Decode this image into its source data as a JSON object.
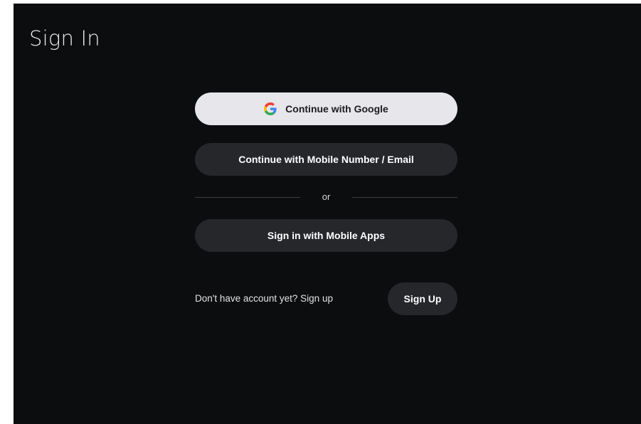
{
  "page": {
    "title": "Sign In"
  },
  "auth_options": {
    "google_label": "Continue with Google",
    "mobile_email_label": "Continue with Mobile Number / Email",
    "separator_text": "or",
    "mobile_apps_label": "Sign in with Mobile Apps"
  },
  "signup": {
    "prompt": "Don't have account yet? Sign up",
    "button_label": "Sign Up"
  },
  "icons": {
    "google": "google-logo-icon"
  },
  "colors": {
    "background": "#0c0d0f",
    "primary_button": "#e6e6eb",
    "secondary_button": "#25272b",
    "google_blue": "#4285F4",
    "google_red": "#EA4335",
    "google_yellow": "#FBBC05",
    "google_green": "#34A853"
  }
}
